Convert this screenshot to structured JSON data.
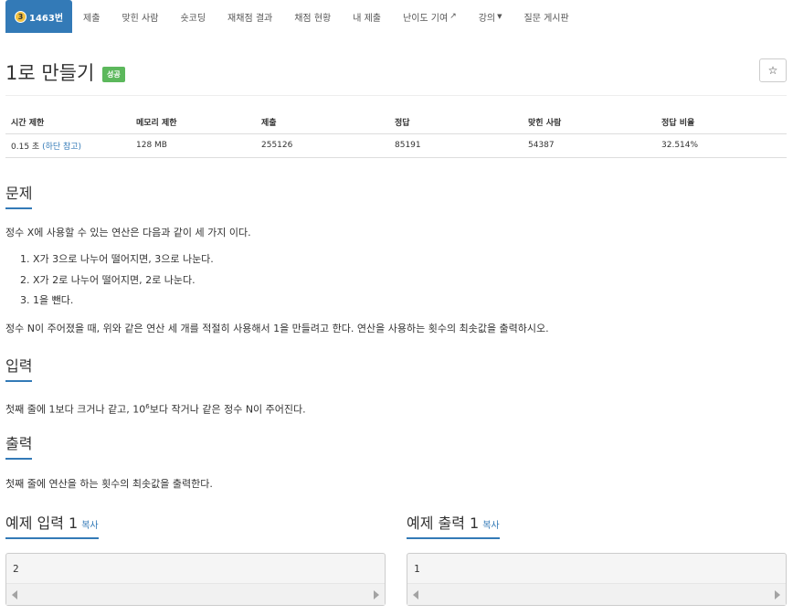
{
  "nav": {
    "tier": "3",
    "problem_tab": "1463번",
    "tabs": [
      "제출",
      "맞힌 사람",
      "숏코딩",
      "재채점 결과",
      "채점 현황",
      "내 제출",
      "난이도 기여",
      "강의",
      "질문 게시판"
    ]
  },
  "title": {
    "text": "1로 만들기",
    "badge": "성공",
    "star": "☆"
  },
  "info": {
    "headers": [
      "시간 제한",
      "메모리 제한",
      "제출",
      "정답",
      "맞힌 사람",
      "정답 비율"
    ],
    "time": "0.15 초",
    "time_note": "(하단 참고)",
    "memory": "128 MB",
    "submissions": "255126",
    "accepted": "85191",
    "solvers": "54387",
    "ratio": "32.514%"
  },
  "sections": {
    "problem": "문제",
    "input": "입력",
    "output": "출력",
    "sample_input": "예제 입력 1",
    "sample_output": "예제 출력 1",
    "copy": "복사"
  },
  "problem": {
    "intro": "정수 X에 사용할 수 있는 연산은 다음과 같이 세 가지 이다.",
    "ops": [
      "1. X가 3으로 나누어 떨어지면, 3으로 나눈다.",
      "2. X가 2로 나누어 떨어지면, 2로 나눈다.",
      "3. 1을 뺀다."
    ],
    "outro": "정수 N이 주어졌을 때, 위와 같은 연산 세 개를 적절히 사용해서 1을 만들려고 한다. 연산을 사용하는 횟수의 최솟값을 출력하시오."
  },
  "input": {
    "before": "첫째 줄에 1보다 크거나 같고, 10",
    "sup": "6",
    "after": "보다 작거나 같은 정수 N이 주어진다."
  },
  "output": {
    "text": "첫째 줄에 연산을 하는 횟수의 최솟값을 출력한다."
  },
  "samples": {
    "input_value": "2",
    "output_value": "1"
  },
  "colors": {
    "accent": "#337ab7",
    "success": "#5cb85c"
  }
}
